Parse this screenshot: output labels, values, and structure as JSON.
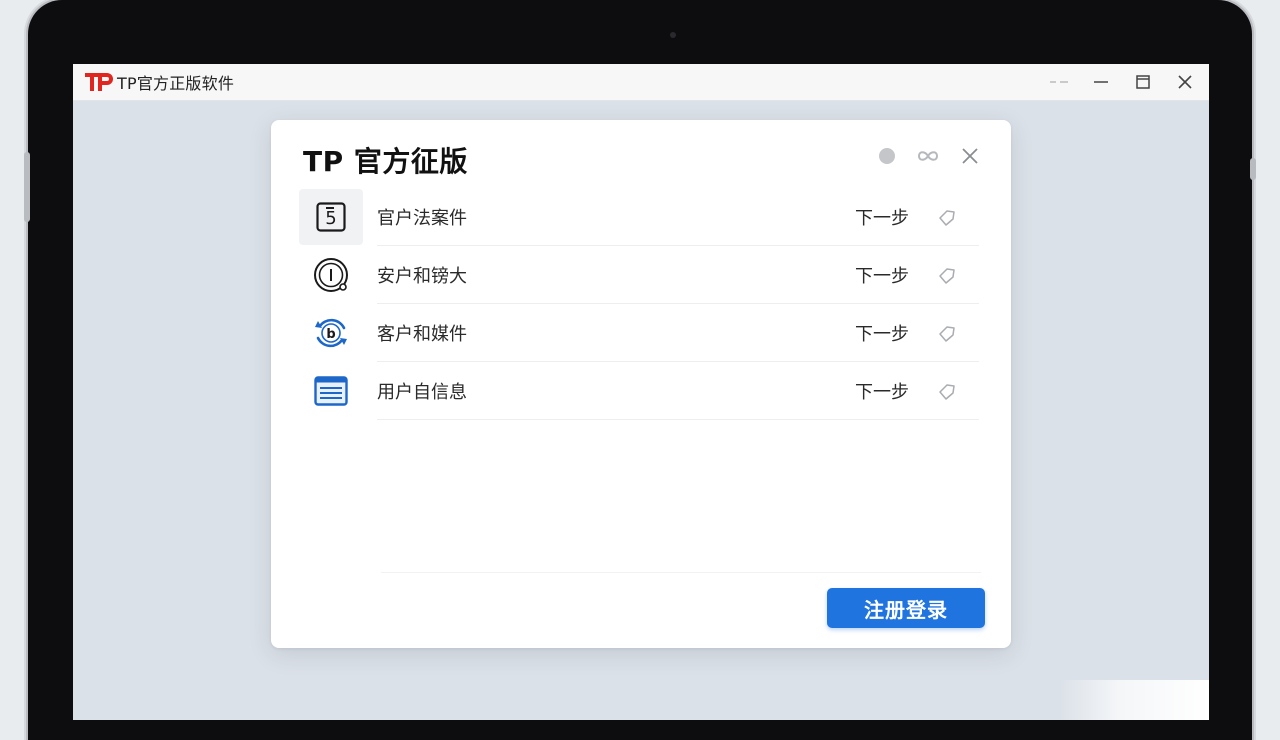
{
  "window": {
    "app_title": "TP官方正版软件",
    "logo_text": "TP",
    "controls": [
      "pin",
      "minimize",
      "maximize",
      "close"
    ]
  },
  "dialog": {
    "title": "TP 官方征版",
    "tools": [
      "status-dot-icon",
      "link-icon",
      "close-icon"
    ],
    "items": [
      {
        "label": "官户法案件",
        "action": "下一步",
        "icon": "document-five-icon",
        "selected": true
      },
      {
        "label": "安户和镑大",
        "action": "下一步",
        "icon": "time-badge-icon",
        "selected": false
      },
      {
        "label": "客户和媒件",
        "action": "下一步",
        "icon": "bitcoin-refresh-icon",
        "selected": false
      },
      {
        "label": "用户自信息",
        "action": "下一步",
        "icon": "id-card-icon",
        "selected": false
      }
    ],
    "primary_button": "注册登录"
  },
  "colors": {
    "accent": "#1f74e0",
    "logo_red": "#e0261f",
    "screen_bg": "#dbe1e8"
  }
}
